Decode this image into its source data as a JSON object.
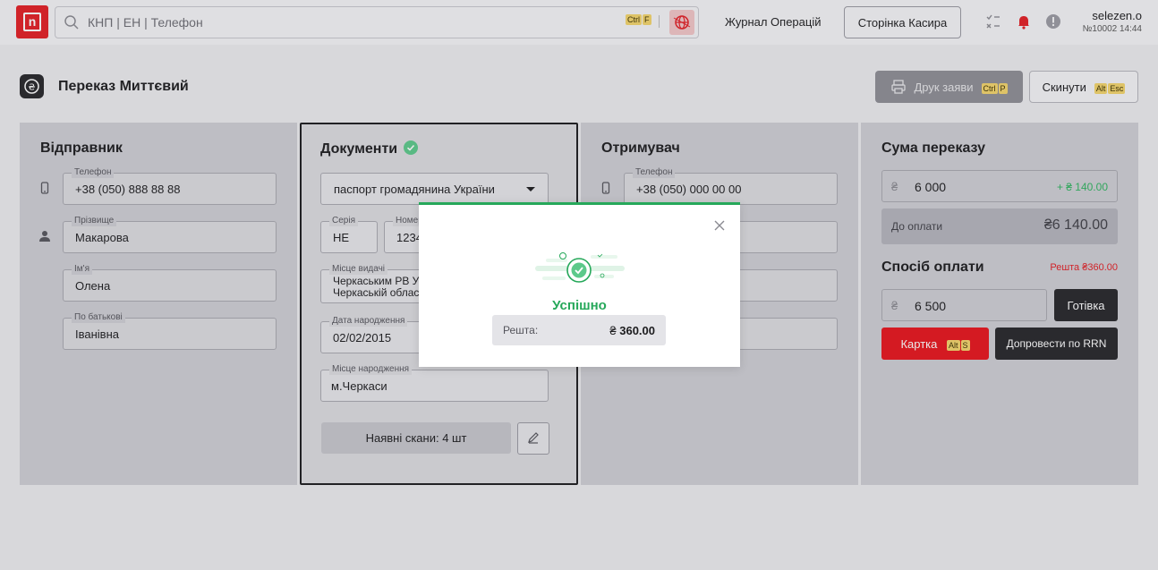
{
  "header": {
    "logo_letter": "n",
    "search_placeholder": "КНП | ЕН | Телефон",
    "search_hotkey": [
      "Ctrl",
      "F"
    ],
    "journal_link": "Журнал Операцій",
    "cashier_button": "Сторінка Касира",
    "user_name": "selezen.o",
    "user_meta": "№10002 14:44"
  },
  "page": {
    "title": "Переказ Миттєвий",
    "print_button": "Друк заяви",
    "print_hotkey": [
      "Ctrl",
      "P"
    ],
    "reset_button": "Скинути",
    "reset_hotkey": [
      "Alt",
      "Esc"
    ]
  },
  "sender": {
    "title": "Відправник",
    "phone_label": "Телефон",
    "phone": "+38 (050) 888 88 88",
    "surname_label": "Прізвище",
    "surname": "Макарова",
    "name_label": "Ім'я",
    "name": "Олена",
    "patronymic_label": "По батькові",
    "patronymic": "Іванівна"
  },
  "documents": {
    "title": "Документи",
    "doc_type": "паспорт громадянина України",
    "series_label": "Серія",
    "series": "НЕ",
    "number_label": "Номер",
    "number": "1234",
    "issued_label": "Місце видачі",
    "issued_line1": "Черкаським РВ У",
    "issued_line2": "Черкаській облас",
    "birthdate_label": "Дата народження",
    "birthdate": "02/02/2015",
    "birthplace_label": "Місце народження",
    "birthplace": "м.Черкаси",
    "scans_button": "Наявні скани: 4 шт"
  },
  "receiver": {
    "title": "Отримувач",
    "phone_label": "Телефон",
    "phone": "+38 (050) 000 00 00"
  },
  "amount": {
    "title": "Сума переказу",
    "currency_sign": "₴",
    "sum": "6 000",
    "commission": "+ ₴ 140.00",
    "to_pay_label": "До оплати",
    "to_pay": "₴6 140.00",
    "payment_title": "Спосіб оплати",
    "change_text": "Решта ₴360.00",
    "cash_value": "6 500",
    "cash_button": "Готівка",
    "card_button": "Картка",
    "card_hotkey": [
      "Alt",
      "S"
    ],
    "rrn_button": "Допровести по RRN"
  },
  "modal": {
    "message": "Успішно",
    "change_label": "Решта:",
    "change_currency": "₴",
    "change_value": "360.00"
  },
  "colors": {
    "brand_red": "#e31e24",
    "success_green": "#26a85a",
    "dark_button": "#26262a"
  },
  "icons": [
    "search-icon",
    "globe-icon",
    "checklist-icon",
    "bell-icon",
    "alert-icon",
    "printer-icon",
    "phone-icon",
    "person-icon",
    "check-circle-icon",
    "pencil-icon",
    "close-icon"
  ]
}
